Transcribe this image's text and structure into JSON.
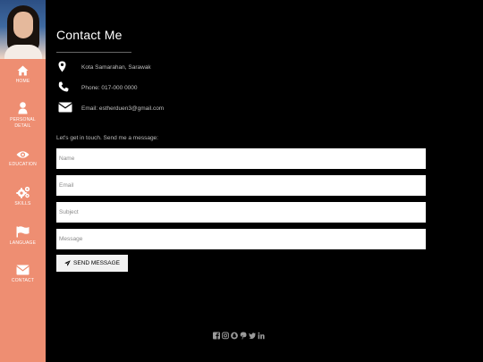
{
  "sidebar": {
    "items": [
      {
        "label": "HOME",
        "icon": "home-icon"
      },
      {
        "label": "PERSONAL DETAIL",
        "icon": "user-icon"
      },
      {
        "label": "EDUCATION",
        "icon": "eye-icon"
      },
      {
        "label": "SKILLS",
        "icon": "gears-icon"
      },
      {
        "label": "LANGUAGE",
        "icon": "flag-icon"
      },
      {
        "label": "CONTACT",
        "icon": "envelope-icon"
      }
    ],
    "color": "#ee8e72"
  },
  "main": {
    "title": "Contact Me",
    "info": [
      {
        "icon": "map-marker-icon",
        "text": "Kota Samarahan, Sarawak"
      },
      {
        "icon": "phone-icon",
        "text": "Phone: 017-000 0000"
      },
      {
        "icon": "envelope-icon",
        "text": "Email: estherduen3@gmail.com"
      }
    ],
    "intro": "Let's get in touch. Send me a message:",
    "form": {
      "name_placeholder": "Name",
      "email_placeholder": "Email",
      "subject_placeholder": "Subject",
      "message_placeholder": "Message",
      "send_label": "SEND MESSAGE"
    }
  },
  "footer": {
    "social_icons": [
      "facebook-icon",
      "instagram-icon",
      "snapchat-icon",
      "pinterest-icon",
      "twitter-icon",
      "linkedin-icon"
    ]
  }
}
